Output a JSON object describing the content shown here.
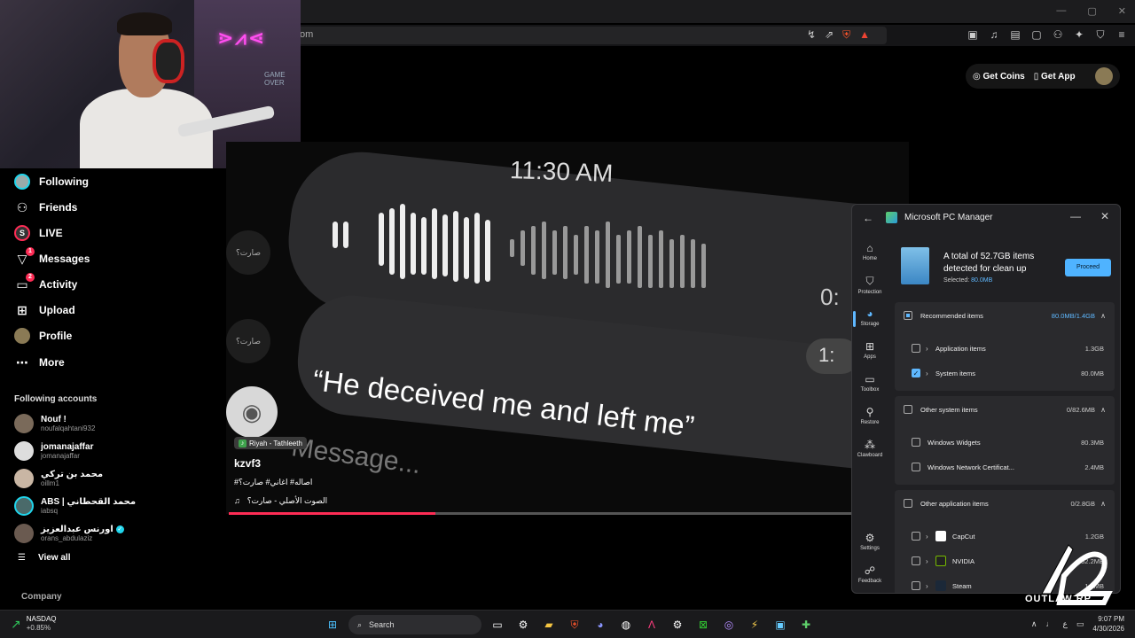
{
  "browser": {
    "url_fragment": "om",
    "window_controls": [
      "—",
      "▢",
      "✕"
    ]
  },
  "top_actions": {
    "coins": "Get Coins",
    "app": "Get App"
  },
  "sidebar": {
    "nav": [
      {
        "label": "Following",
        "icon": "following-avatar-icon"
      },
      {
        "label": "Friends",
        "icon": "friends-icon"
      },
      {
        "label": "LIVE",
        "icon": "live-icon"
      },
      {
        "label": "Messages",
        "icon": "messages-icon",
        "badge": "1"
      },
      {
        "label": "Activity",
        "icon": "activity-icon",
        "badge": "2"
      },
      {
        "label": "Upload",
        "icon": "upload-icon"
      },
      {
        "label": "Profile",
        "icon": "profile-avatar-icon"
      },
      {
        "label": "More",
        "icon": "more-icon"
      }
    ],
    "following_title": "Following accounts",
    "accounts": [
      {
        "name": "Nouf !",
        "handle": "noufalqahtani932",
        "verified": false
      },
      {
        "name": "jomanajaffar",
        "handle": "jomanajaffar",
        "verified": false
      },
      {
        "name": "محمد بن تركي",
        "handle": "oillm1",
        "verified": false
      },
      {
        "name": "ABS | محمد القحطاني",
        "handle": "iabsq",
        "verified": false
      },
      {
        "name": "اورنس عبدالعزيز",
        "handle": "orans_abdulaziz",
        "verified": true
      }
    ],
    "view_all": "View all",
    "company": "Company"
  },
  "video": {
    "time": "11:30 AM",
    "quote": "“He deceived me and left me”",
    "message_placeholder": "Message...",
    "side_text_1": "صارت؟",
    "side_text_2": "صارت؟",
    "timer": "0:",
    "timer2": "1:",
    "music_tag": "Riyah - Tathleeth",
    "author": "kzvf3",
    "tags": "#اصاله# اغاني# صارت؟",
    "sound": "الصوت الأصلي - صارت؟",
    "progress": 0.33
  },
  "pcm": {
    "title": "Microsoft PC Manager",
    "summary": "A total of 52.7GB items detected for clean up",
    "selected_label": "Selected:",
    "selected_value": "80.0MB",
    "proceed": "Proceed",
    "nav": [
      {
        "label": "Home",
        "glyph": "⌂"
      },
      {
        "label": "Protection",
        "glyph": "⛉"
      },
      {
        "label": "Storage",
        "glyph": "◕"
      },
      {
        "label": "Apps",
        "glyph": "⊞"
      },
      {
        "label": "Toolbox",
        "glyph": "▭"
      },
      {
        "label": "Restore",
        "glyph": "⚲"
      },
      {
        "label": "Clawboard",
        "glyph": "⁂"
      },
      {
        "label": "Settings",
        "glyph": "⚙"
      },
      {
        "label": "Feedback",
        "glyph": "☍"
      }
    ],
    "recommended": {
      "label": "Recommended items",
      "value": "80.0MB/1.4GB"
    },
    "recommended_items": [
      {
        "label": "Application items",
        "value": "1.3GB",
        "checked": false
      },
      {
        "label": "System items",
        "value": "80.0MB",
        "checked": true
      }
    ],
    "other_system": {
      "label": "Other system items",
      "value": "0/82.6MB"
    },
    "other_system_items": [
      {
        "label": "Windows Widgets",
        "value": "80.3MB"
      },
      {
        "label": "Windows Network Certificat...",
        "value": "2.4MB"
      }
    ],
    "other_app": {
      "label": "Other application items",
      "value": "0/2.8GB"
    },
    "other_app_items": [
      {
        "label": "CapCut",
        "value": "1.2GB"
      },
      {
        "label": "NVIDIA",
        "value": "52.2MB"
      },
      {
        "label": "Steam",
        "value": "1.1MB"
      }
    ]
  },
  "watermark": "OUTLAW RP",
  "taskbar": {
    "stock_name": "NASDAQ",
    "stock_value": "+0.85%",
    "search": "Search",
    "time": "9:07 PM",
    "date": "4/30/2026",
    "lang": "ع"
  }
}
